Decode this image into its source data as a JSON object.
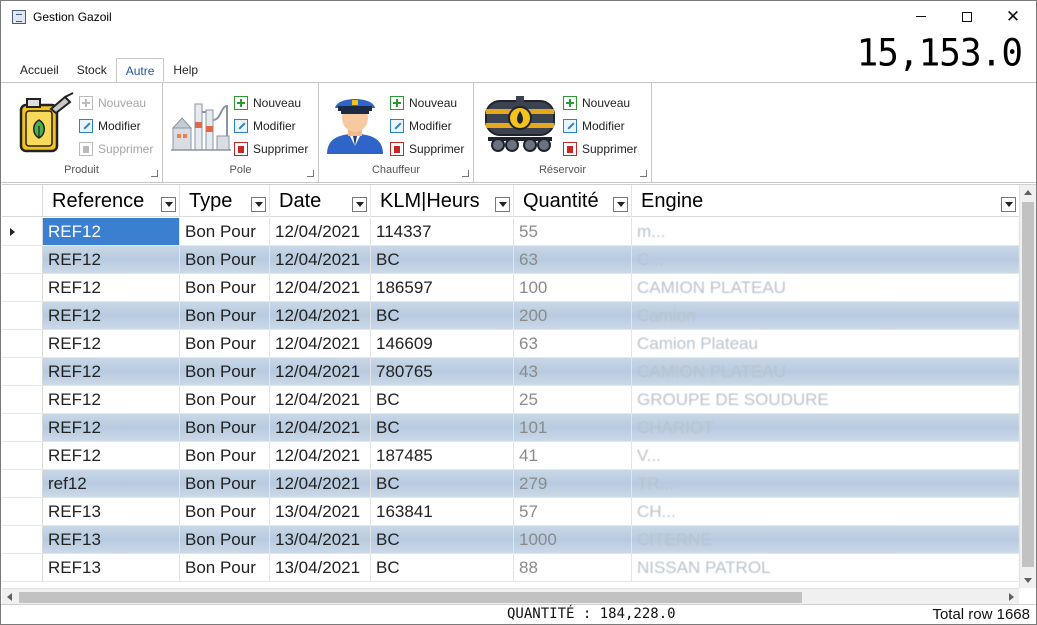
{
  "window": {
    "title": "Gestion Gazoil"
  },
  "counter": "15,153.0",
  "tabs": [
    {
      "label": "Accueil",
      "active": false
    },
    {
      "label": "Stock",
      "active": false
    },
    {
      "label": "Autre",
      "active": true
    },
    {
      "label": "Help",
      "active": false
    }
  ],
  "ribbon": {
    "groups": [
      {
        "label": "Produit",
        "icon": "fuel-can-icon",
        "buttons": {
          "new": "Nouveau",
          "edit": "Modifier",
          "delete": "Supprimer"
        },
        "disabled": {
          "new": true,
          "edit": false,
          "delete": true
        }
      },
      {
        "label": "Pole",
        "icon": "factory-icon",
        "buttons": {
          "new": "Nouveau",
          "edit": "Modifier",
          "delete": "Supprimer"
        },
        "disabled": {
          "new": false,
          "edit": false,
          "delete": false
        }
      },
      {
        "label": "Chauffeur",
        "icon": "driver-icon",
        "buttons": {
          "new": "Nouveau",
          "edit": "Modifier",
          "delete": "Supprimer"
        },
        "disabled": {
          "new": false,
          "edit": false,
          "delete": false
        }
      },
      {
        "label": "Réservoir",
        "icon": "fuel-tank-icon",
        "buttons": {
          "new": "Nouveau",
          "edit": "Modifier",
          "delete": "Supprimer"
        },
        "disabled": {
          "new": false,
          "edit": false,
          "delete": false
        }
      }
    ]
  },
  "grid": {
    "columns": [
      "Reference",
      "Type",
      "Date",
      "KLM|Heurs",
      "Quantité",
      "Engine"
    ],
    "rows": [
      [
        "REF12",
        "Bon Pour",
        "12/04/2021",
        "114337",
        "55",
        "m..."
      ],
      [
        "REF12",
        "Bon Pour",
        "12/04/2021",
        "BC",
        "63",
        "C..."
      ],
      [
        "REF12",
        "Bon Pour",
        "12/04/2021",
        "186597",
        "100",
        "CAMION PLATEAU"
      ],
      [
        "REF12",
        "Bon Pour",
        "12/04/2021",
        "BC",
        "200",
        "Camion"
      ],
      [
        "REF12",
        "Bon Pour",
        "12/04/2021",
        "146609",
        "63",
        "Camion Plateau"
      ],
      [
        "REF12",
        "Bon Pour",
        "12/04/2021",
        "780765",
        "43",
        "CAMION PLATEAU"
      ],
      [
        "REF12",
        "Bon Pour",
        "12/04/2021",
        "BC",
        "25",
        "GROUPE DE SOUDURE"
      ],
      [
        "REF12",
        "Bon Pour",
        "12/04/2021",
        "BC",
        "101",
        "CHARIOT"
      ],
      [
        "REF12",
        "Bon Pour",
        "12/04/2021",
        "187485",
        "41",
        "V..."
      ],
      [
        "ref12",
        "Bon Pour",
        "12/04/2021",
        "BC",
        "279",
        "TR..."
      ],
      [
        "REF13",
        "Bon Pour",
        "13/04/2021",
        "163841",
        "57",
        "CH..."
      ],
      [
        "REF13",
        "Bon Pour",
        "13/04/2021",
        "BC",
        "1000",
        "CITERNE"
      ],
      [
        "REF13",
        "Bon Pour",
        "13/04/2021",
        "BC",
        "88",
        "NISSAN PATROL"
      ]
    ]
  },
  "status": {
    "quantity": "QUANTITÉ : 184,228.0",
    "total": "Total row 1668"
  }
}
